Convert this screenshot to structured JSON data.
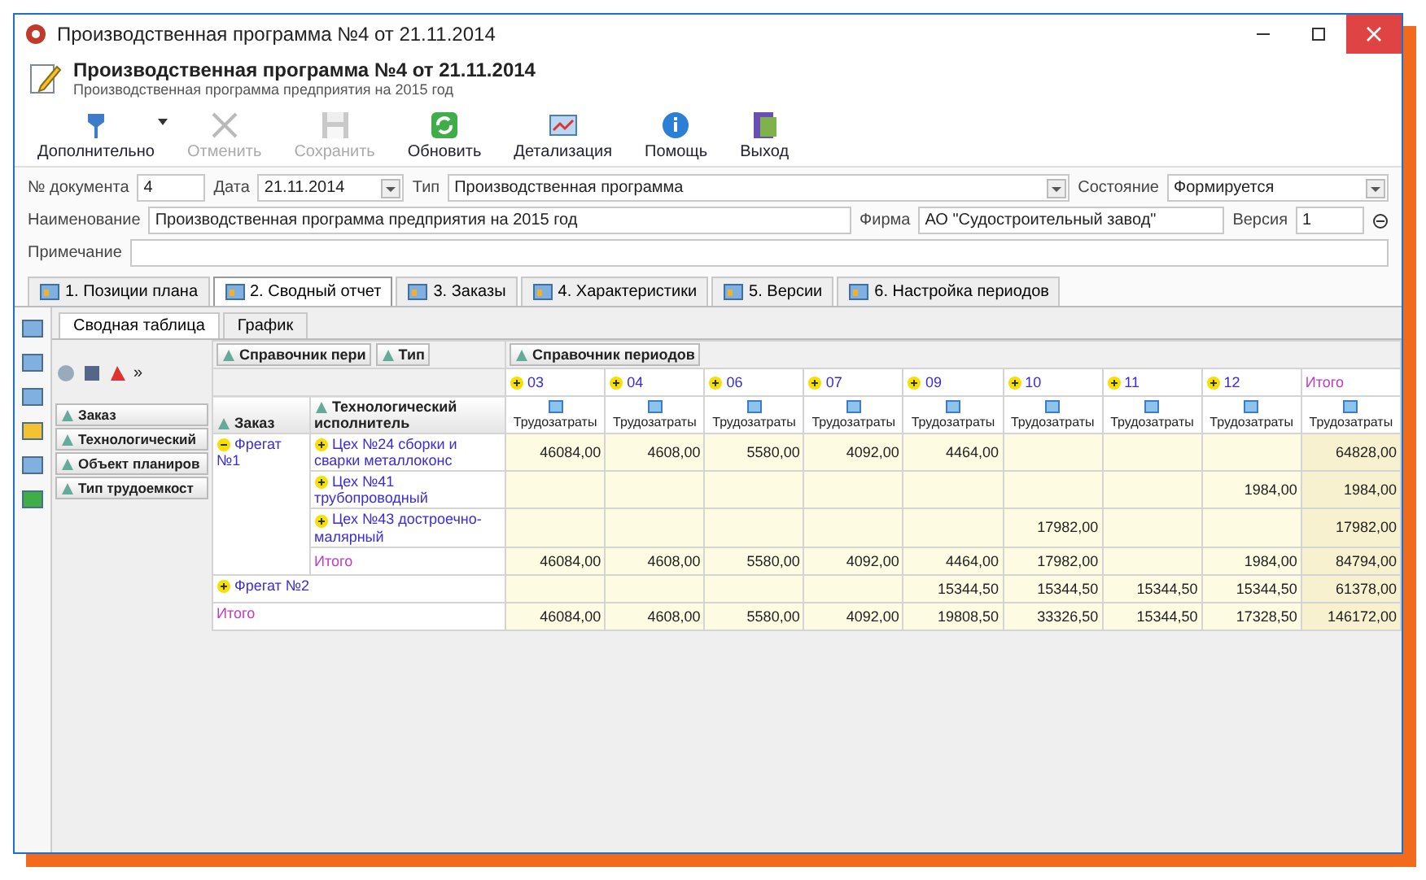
{
  "window": {
    "title": "Производственная программа №4 от 21.11.2014"
  },
  "header": {
    "title": "Производственная программа №4 от 21.11.2014",
    "subtitle": "Производственная программа предприятия на 2015 год"
  },
  "toolbar": [
    {
      "kind": "more",
      "label": "Дополнительно",
      "disabled": false
    },
    {
      "kind": "cancel",
      "label": "Отменить",
      "disabled": true
    },
    {
      "kind": "save",
      "label": "Сохранить",
      "disabled": true
    },
    {
      "kind": "refresh",
      "label": "Обновить",
      "disabled": false
    },
    {
      "kind": "details",
      "label": "Детализация",
      "disabled": false
    },
    {
      "kind": "help",
      "label": "Помощь",
      "disabled": false
    },
    {
      "kind": "exit",
      "label": "Выход",
      "disabled": false
    }
  ],
  "form": {
    "doc_number": {
      "label": "№ документа",
      "value": "4"
    },
    "date": {
      "label": "Дата",
      "value": "21.11.2014"
    },
    "type": {
      "label": "Тип",
      "value": "Производственная программа"
    },
    "state": {
      "label": "Состояние",
      "value": "Формируется"
    },
    "name": {
      "label": "Наименование",
      "value": "Производственная программа предприятия на 2015 год"
    },
    "firm": {
      "label": "Фирма",
      "value": "АО \"Судостроительный завод\""
    },
    "version": {
      "label": "Версия",
      "value": "1"
    },
    "note": {
      "label": "Примечание"
    }
  },
  "tabs": [
    {
      "label": "1. Позиции плана",
      "selected": false
    },
    {
      "label": "2. Сводный отчет",
      "selected": true
    },
    {
      "label": "3. Заказы",
      "selected": false
    },
    {
      "label": "4. Характеристики",
      "selected": false
    },
    {
      "label": "5. Версии",
      "selected": false
    },
    {
      "label": "6. Настройка периодов",
      "selected": false
    }
  ],
  "subtabs": [
    {
      "label": "Сводная таблица",
      "selected": true
    },
    {
      "label": "График",
      "selected": false
    }
  ],
  "pivot": {
    "more": "»",
    "field_list": [
      "Заказ",
      "Технологический",
      "Объект планиров",
      "Тип трудоемкост"
    ],
    "filter_fields": [
      "Справочник пери",
      "Тип"
    ],
    "column_field": "Справочник периодов",
    "row_headers": [
      "Заказ",
      "Технологический исполнитель"
    ],
    "columns": [
      {
        "period": "03",
        "measure": "Трудозатраты",
        "kind": "period"
      },
      {
        "period": "04",
        "measure": "Трудозатраты",
        "kind": "period"
      },
      {
        "period": "06",
        "measure": "Трудозатраты",
        "kind": "period"
      },
      {
        "period": "07",
        "measure": "Трудозатраты",
        "kind": "period"
      },
      {
        "period": "09",
        "measure": "Трудозатраты",
        "kind": "period"
      },
      {
        "period": "10",
        "measure": "Трудозатраты",
        "kind": "period"
      },
      {
        "period": "11",
        "measure": "Трудозатраты",
        "kind": "period"
      },
      {
        "period": "12",
        "measure": "Трудозатраты",
        "kind": "period"
      },
      {
        "period": "Итого",
        "measure": "Трудозатраты",
        "kind": "total"
      }
    ],
    "rows": [
      {
        "label": "Фрегат №1",
        "expanded": true,
        "children": [
          {
            "label": "Цех №24 сборки и сварки металлоконс",
            "cells": [
              {
                "kind": "value",
                "text": "46084,00"
              },
              {
                "kind": "value",
                "text": "4608,00"
              },
              {
                "kind": "value",
                "text": "5580,00"
              },
              {
                "kind": "value",
                "text": "4092,00"
              },
              {
                "kind": "value",
                "text": "4464,00"
              },
              {
                "kind": "empty"
              },
              {
                "kind": "empty"
              },
              {
                "kind": "empty"
              },
              {
                "kind": "value",
                "text": "64828,00"
              }
            ]
          },
          {
            "label": "Цех №41 трубопроводный",
            "cells": [
              {
                "kind": "empty"
              },
              {
                "kind": "empty"
              },
              {
                "kind": "empty"
              },
              {
                "kind": "empty"
              },
              {
                "kind": "empty"
              },
              {
                "kind": "empty"
              },
              {
                "kind": "empty"
              },
              {
                "kind": "value",
                "text": "1984,00"
              },
              {
                "kind": "value",
                "text": "1984,00"
              }
            ]
          },
          {
            "label": "Цех №43 достроечно-малярный",
            "cells": [
              {
                "kind": "empty"
              },
              {
                "kind": "empty"
              },
              {
                "kind": "empty"
              },
              {
                "kind": "empty"
              },
              {
                "kind": "empty"
              },
              {
                "kind": "value",
                "text": "17982,00"
              },
              {
                "kind": "empty"
              },
              {
                "kind": "empty"
              },
              {
                "kind": "value",
                "text": "17982,00"
              }
            ]
          }
        ],
        "subtotal": {
          "label": "Итого",
          "cells": [
            {
              "kind": "value",
              "text": "46084,00"
            },
            {
              "kind": "value",
              "text": "4608,00"
            },
            {
              "kind": "value",
              "text": "5580,00"
            },
            {
              "kind": "value",
              "text": "4092,00"
            },
            {
              "kind": "value",
              "text": "4464,00"
            },
            {
              "kind": "value",
              "text": "17982,00"
            },
            {
              "kind": "empty"
            },
            {
              "kind": "value",
              "text": "1984,00"
            },
            {
              "kind": "value",
              "text": "84794,00"
            }
          ]
        }
      },
      {
        "label": "Фрегат №2",
        "expanded": false,
        "cells": [
          {
            "kind": "empty"
          },
          {
            "kind": "empty"
          },
          {
            "kind": "empty"
          },
          {
            "kind": "empty"
          },
          {
            "kind": "value",
            "text": "15344,50"
          },
          {
            "kind": "value",
            "text": "15344,50"
          },
          {
            "kind": "value",
            "text": "15344,50"
          },
          {
            "kind": "value",
            "text": "15344,50"
          },
          {
            "kind": "value",
            "text": "61378,00"
          }
        ]
      }
    ],
    "grand_total": {
      "label": "Итого",
      "cells": [
        {
          "kind": "value",
          "text": "46084,00"
        },
        {
          "kind": "value",
          "text": "4608,00"
        },
        {
          "kind": "value",
          "text": "5580,00"
        },
        {
          "kind": "value",
          "text": "4092,00"
        },
        {
          "kind": "value",
          "text": "19808,50"
        },
        {
          "kind": "value",
          "text": "33326,50"
        },
        {
          "kind": "value",
          "text": "15344,50"
        },
        {
          "kind": "value",
          "text": "17328,50"
        },
        {
          "kind": "value",
          "text": "146172,00"
        }
      ]
    }
  }
}
